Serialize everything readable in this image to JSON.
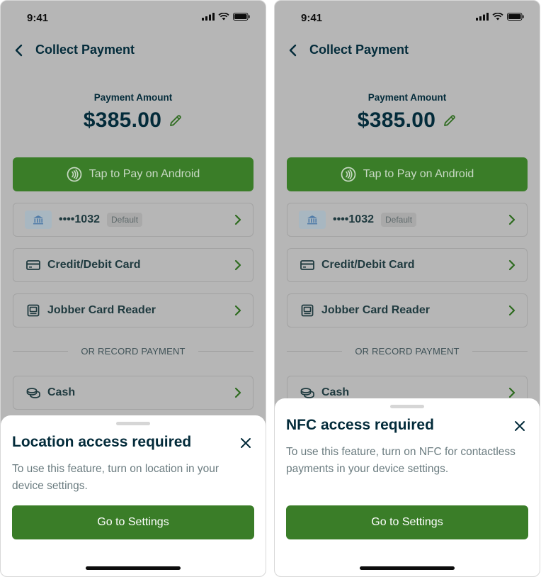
{
  "screens": [
    {
      "status_time": "9:41",
      "header": {
        "title": "Collect Payment"
      },
      "amount": {
        "label": "Payment Amount",
        "value": "$385.00"
      },
      "tap_to_pay_label": "Tap to Pay on Android",
      "bank": {
        "number": "••••1032",
        "badge": "Default"
      },
      "methods": [
        "Credit/Debit Card",
        "Jobber Card Reader"
      ],
      "divider_text": "OR RECORD PAYMENT",
      "cash_label": "Cash",
      "sheet": {
        "title": "Location access required",
        "body": "To use this feature, turn on location in your device settings.",
        "button_label": "Go to Settings"
      }
    },
    {
      "status_time": "9:41",
      "header": {
        "title": "Collect Payment"
      },
      "amount": {
        "label": "Payment Amount",
        "value": "$385.00"
      },
      "tap_to_pay_label": "Tap to Pay on Android",
      "bank": {
        "number": "••••1032",
        "badge": "Default"
      },
      "methods": [
        "Credit/Debit Card",
        "Jobber Card Reader"
      ],
      "divider_text": "OR RECORD PAYMENT",
      "cash_label": "Cash",
      "sheet": {
        "title": "NFC access required",
        "body": "To use this feature, turn on NFC for contactless payments in your device settings.",
        "button_label": "Go to Settings"
      }
    }
  ],
  "icons": {
    "back": "chevron-left-icon",
    "edit": "pencil-icon",
    "nfc": "contactless-icon",
    "bank": "bank-icon",
    "card": "credit-card-icon",
    "reader": "card-reader-icon",
    "cash": "coins-icon",
    "chevron": "chevron-right-icon",
    "close": "close-icon"
  },
  "colors": {
    "brand_green": "#3a7d28",
    "heading": "#032b3a",
    "overlay_background": "#b6b6b6",
    "chevron_green": "#2e6b1f"
  }
}
